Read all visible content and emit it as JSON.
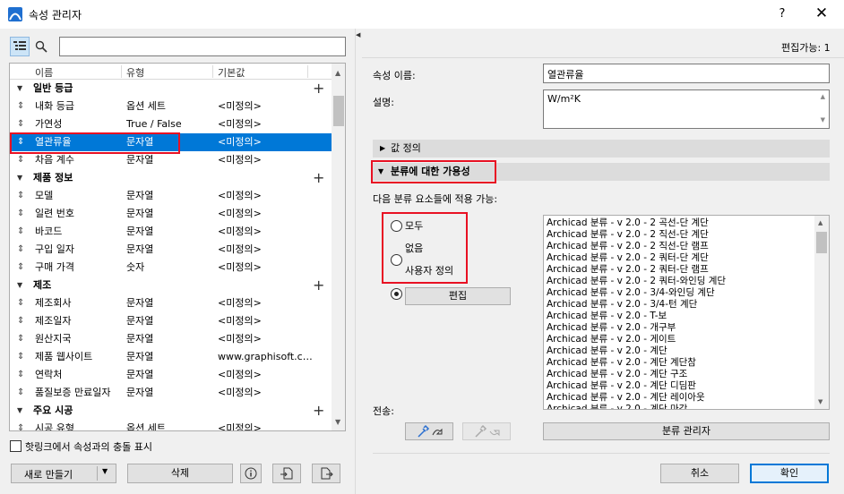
{
  "window": {
    "title": "속성 관리자",
    "help": "?",
    "close": "✕"
  },
  "left": {
    "search_placeholder": "",
    "columns": [
      "이름",
      "유형",
      "기본값"
    ],
    "rows": [
      {
        "kind": "group",
        "name": "일반 등급"
      },
      {
        "kind": "item",
        "name": "내화 등급",
        "type": "옵션 세트",
        "default": "<미정의>"
      },
      {
        "kind": "item",
        "name": "가연성",
        "type": "True / False",
        "default": "<미정의>"
      },
      {
        "kind": "item",
        "name": "열관류율",
        "type": "문자열",
        "default": "<미정의>",
        "selected": true
      },
      {
        "kind": "item",
        "name": "차음 계수",
        "type": "문자열",
        "default": "<미정의>"
      },
      {
        "kind": "group",
        "name": "제품 정보"
      },
      {
        "kind": "item",
        "name": "모델",
        "type": "문자열",
        "default": "<미정의>"
      },
      {
        "kind": "item",
        "name": "일련 번호",
        "type": "문자열",
        "default": "<미정의>"
      },
      {
        "kind": "item",
        "name": "바코드",
        "type": "문자열",
        "default": "<미정의>"
      },
      {
        "kind": "item",
        "name": "구입 일자",
        "type": "문자열",
        "default": "<미정의>"
      },
      {
        "kind": "item",
        "name": "구매 가격",
        "type": "숫자",
        "default": "<미정의>"
      },
      {
        "kind": "group",
        "name": "제조"
      },
      {
        "kind": "item",
        "name": "제조회사",
        "type": "문자열",
        "default": "<미정의>"
      },
      {
        "kind": "item",
        "name": "제조일자",
        "type": "문자열",
        "default": "<미정의>"
      },
      {
        "kind": "item",
        "name": "원산지국",
        "type": "문자열",
        "default": "<미정의>"
      },
      {
        "kind": "item",
        "name": "제품 웹사이트",
        "type": "문자열",
        "default": "www.graphisoft.co..."
      },
      {
        "kind": "item",
        "name": "연락처",
        "type": "문자열",
        "default": "<미정의>"
      },
      {
        "kind": "item",
        "name": "품질보증 만료일자",
        "type": "문자열",
        "default": "<미정의>"
      },
      {
        "kind": "group",
        "name": "주요 시공"
      },
      {
        "kind": "item",
        "name": "시공 유형",
        "type": "옵션 세트",
        "default": "<미정의>"
      }
    ],
    "hotlink_checkbox": "핫링크에서 속성과의 충돌 표시",
    "new_button": "새로 만들기",
    "delete_button": "삭제"
  },
  "right": {
    "editable_label": "편집가능: 1",
    "property_name_label": "속성 이름:",
    "property_name_value": "열관류율",
    "description_label": "설명:",
    "description_value": "W/m²K",
    "value_def_section": "값 정의",
    "availability_section": "분류에 대한 가용성",
    "applicable_label": "다음 분류 요소들에 적용 가능:",
    "radio_all": "모두",
    "radio_none": "없음",
    "radio_custom": "사용자 정의",
    "radio_selected": "custom",
    "edit_button": "편집",
    "classifications": [
      "Archicad 분류 - v 2.0 - 2 곡선-단 계단",
      "Archicad 분류 - v 2.0 - 2 직선-단 계단",
      "Archicad 분류 - v 2.0 - 2 직선-단 램프",
      "Archicad 분류 - v 2.0 - 2 쿼터-단 계단",
      "Archicad 분류 - v 2.0 - 2 쿼터-단 램프",
      "Archicad 분류 - v 2.0 - 2 쿼터-와인딩 계단",
      "Archicad 분류 - v 2.0 - 3/4-와인딩 계단",
      "Archicad 분류 - v 2.0 - 3/4-턴 계단",
      "Archicad 분류 - v 2.0 - T-보",
      "Archicad 분류 - v 2.0 - 개구부",
      "Archicad 분류 - v 2.0 - 게이트",
      "Archicad 분류 - v 2.0 - 계단",
      "Archicad 분류 - v 2.0 - 계단 계단참",
      "Archicad 분류 - v 2.0 - 계단 구조",
      "Archicad 분류 - v 2.0 - 계단 디딤판",
      "Archicad 분류 - v 2.0 - 계단 레이아웃",
      "Archicad 분류 - v 2.0 - 계단 마감"
    ],
    "transfer_label": "전송:",
    "class_manager_button": "분류 관리자",
    "cancel_button": "취소",
    "ok_button": "확인"
  }
}
